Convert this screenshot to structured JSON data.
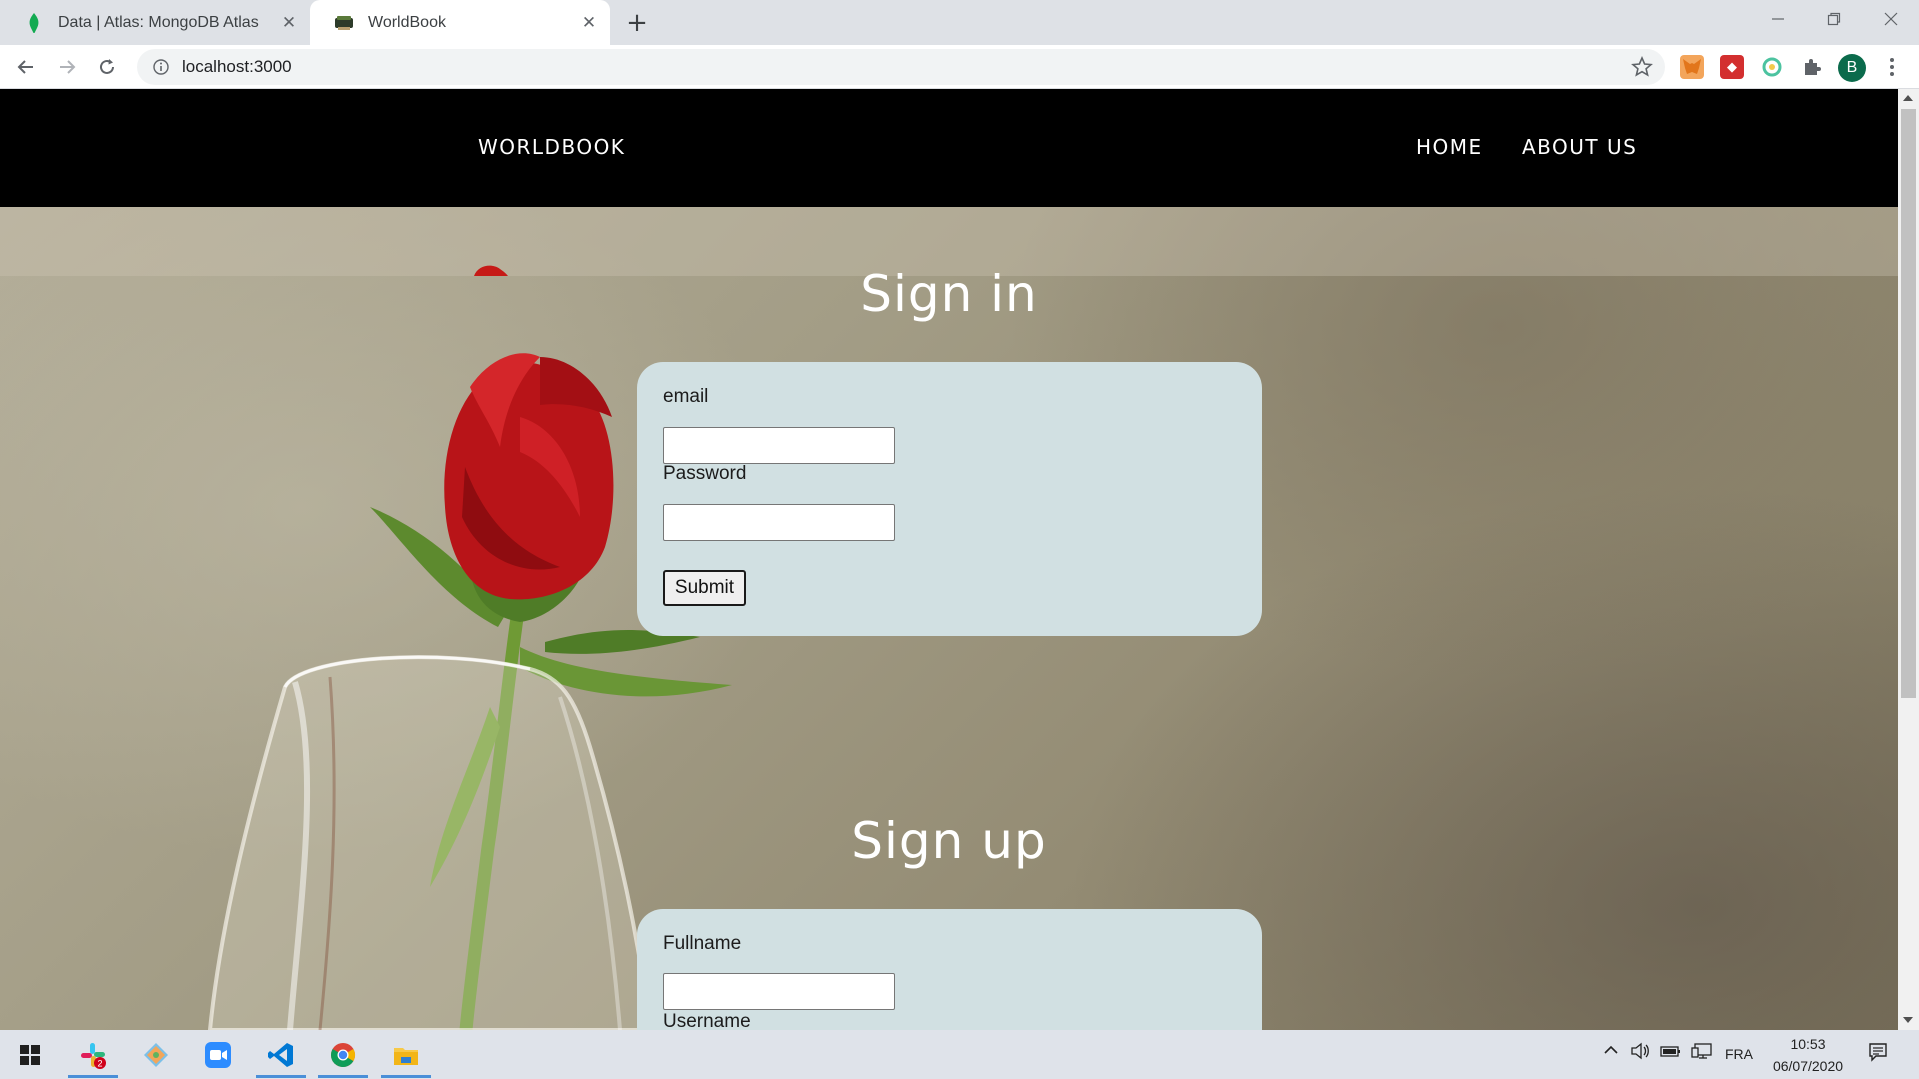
{
  "browser": {
    "tabs": [
      {
        "title": "Data | Atlas: MongoDB Atlas",
        "active": false,
        "icon": "mongodb-leaf-icon"
      },
      {
        "title": "WorldBook",
        "active": true,
        "icon": "worldbook-favicon"
      }
    ],
    "url": "localhost:3000",
    "profile_initial": "B",
    "extensions": [
      "metamask-fox-icon",
      "red-extension-icon",
      "circle-extension-icon",
      "puzzle-icon"
    ]
  },
  "site": {
    "brand": "WORLDBOOK",
    "nav": [
      {
        "label": "HOME"
      },
      {
        "label": "ABOUT US"
      }
    ]
  },
  "signin": {
    "title": "Sign in",
    "email_label": "email",
    "password_label": "Password",
    "submit_label": "Submit"
  },
  "signup": {
    "title": "Sign up",
    "fullname_label": "Fullname",
    "username_label": "Username"
  },
  "taskbar": {
    "apps": [
      "slack-icon",
      "git-icon",
      "zoom-icon",
      "vscode-icon",
      "chrome-icon",
      "file-explorer-icon"
    ],
    "slack_badge": "2",
    "language": "FRA",
    "time": "10:53",
    "date": "06/07/2020"
  },
  "colors": {
    "card_bg": "#d1e0e2",
    "nav_bg": "#000000",
    "profile_bg": "#0b6b4c"
  }
}
